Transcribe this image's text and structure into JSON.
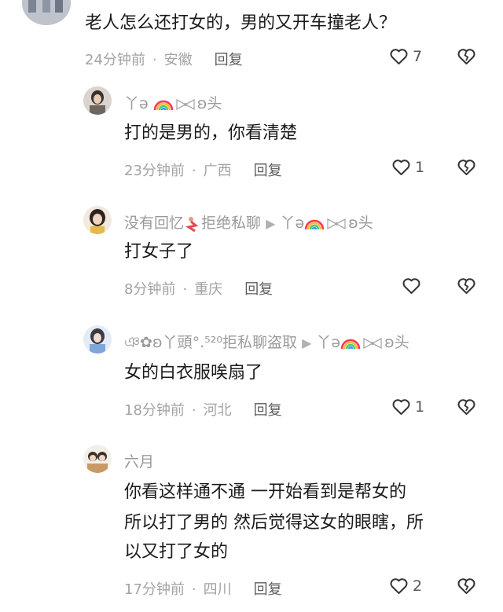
{
  "comments": [
    {
      "text": "老人怎么还打女的，男的又开车撞老人？",
      "time": "24分钟前",
      "region": "安徽",
      "reply": "回复",
      "likes": "7"
    },
    {
      "name_prefix": "丫ə",
      "name_suffix": "ʚ头",
      "text": "打的是男的，你看清楚",
      "time": "23分钟前",
      "region": "广西",
      "reply": "回复",
      "likes": "1"
    },
    {
      "name_a": "没有回忆",
      "name_b": "拒绝私聊",
      "name_c": "丫ə",
      "name_d": "ʚ头",
      "text": "打女子了",
      "time": "8分钟前",
      "region": "重庆",
      "reply": "回复",
      "likes": ""
    },
    {
      "name_a": "ঞ✿ʚ丫頭°.⁵²⁰",
      "name_b": "拒私聊盗取",
      "name_c": "丫ə",
      "name_d": "ʚ头",
      "text": "女的白衣服唉扇了",
      "time": "18分钟前",
      "region": "河北",
      "reply": "回复",
      "likes": "1"
    },
    {
      "name": "六月",
      "text_lines": [
        "你看这样通不通 一开始看到是帮女的",
        "所以打了男的 然后觉得这女的眼瞎，所",
        "以又打了女的"
      ],
      "time": "17分钟前",
      "region": "四川",
      "reply": "回复",
      "likes": "2"
    }
  ],
  "dot": "·",
  "arrow": "▶",
  "icons": {
    "like": "heart-outline-icon",
    "dislike": "broken-heart-outline-icon"
  }
}
